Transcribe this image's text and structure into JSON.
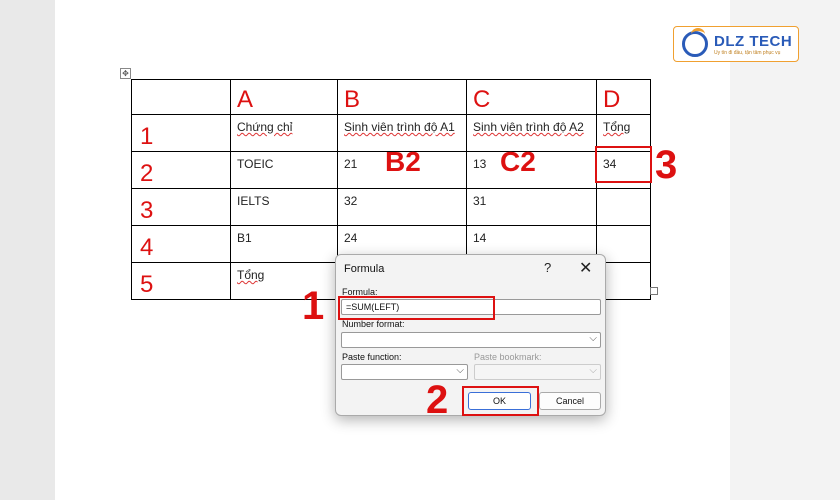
{
  "logo": {
    "text": "DLZ TECH",
    "sub": "Uy tín đi đầu, tận tâm phục vụ"
  },
  "table": {
    "col_headers": [
      "A",
      "B",
      "C",
      "D"
    ],
    "row_headers": [
      "1",
      "2",
      "3",
      "4",
      "5"
    ],
    "rows": [
      [
        "Chứng chỉ",
        "Sinh viên trình độ A1",
        "Sinh viên trình độ A2",
        "Tổng"
      ],
      [
        "TOEIC",
        "21",
        "13",
        "34"
      ],
      [
        "IELTS",
        "32",
        "31",
        ""
      ],
      [
        "B1",
        "24",
        "14",
        ""
      ],
      [
        "Tổng",
        "",
        "",
        ""
      ]
    ]
  },
  "annotations": {
    "b2": "B2",
    "c2": "C2",
    "step1": "1",
    "step2": "2",
    "step3": "3"
  },
  "dialog": {
    "title": "Formula",
    "help": "?",
    "close": "✕",
    "formula_label": "Formula:",
    "formula_value": "=SUM(LEFT)",
    "number_format_label": "Number format:",
    "number_format_value": "",
    "paste_function_label": "Paste function:",
    "paste_function_value": "",
    "paste_bookmark_label": "Paste bookmark:",
    "paste_bookmark_value": "",
    "ok_label": "OK",
    "cancel_label": "Cancel"
  },
  "colors": {
    "annotation_red": "#d11111",
    "accent_blue": "#3a6fd8",
    "logo_blue": "#2a5bb8",
    "logo_orange": "#f0a030"
  }
}
